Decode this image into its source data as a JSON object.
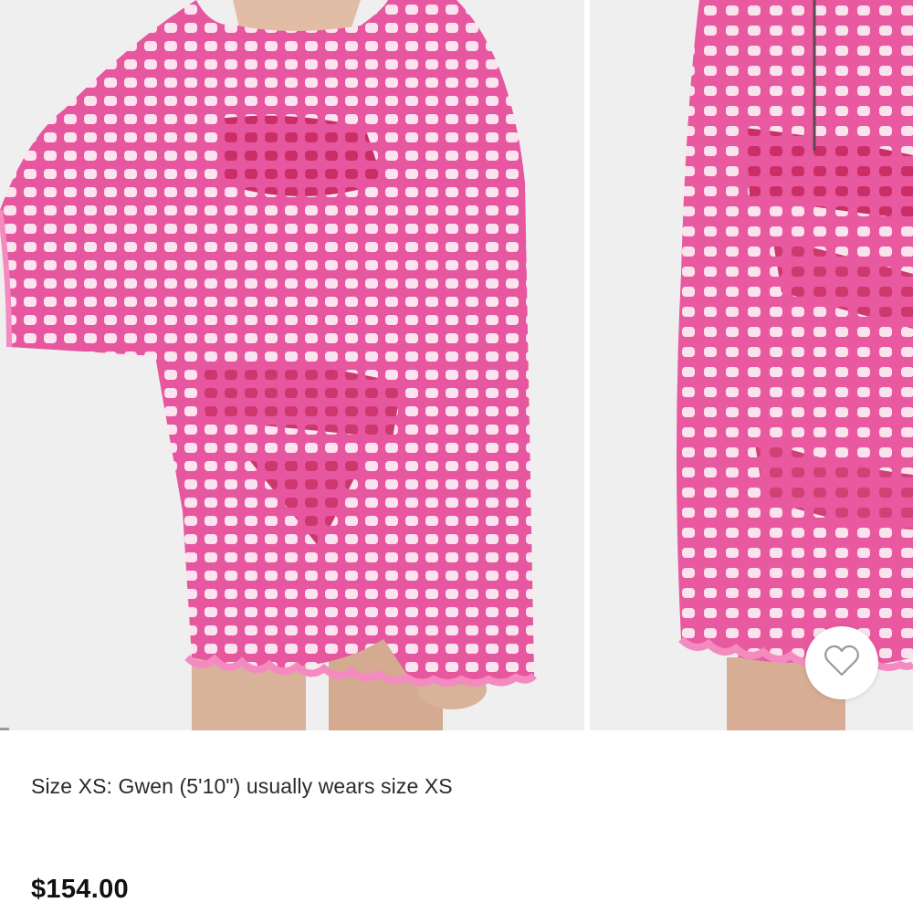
{
  "product": {
    "fit_note": "Size XS: Gwen (5'10\") usually wears size XS",
    "price": "$154.00"
  },
  "gallery": {
    "images": [
      {
        "icon": "pink-crochet-top-front-photo"
      },
      {
        "icon": "pink-crochet-top-detail-photo"
      }
    ],
    "active_index": 0
  },
  "wishlist": {
    "icon": "heart-outline-icon"
  },
  "colors": {
    "crochet_pink": "#f27ab5",
    "crochet_dark": "#e0559c",
    "lining_red": "#c81a58",
    "background": "#f2f2f2",
    "text": "#2b2b2b"
  }
}
